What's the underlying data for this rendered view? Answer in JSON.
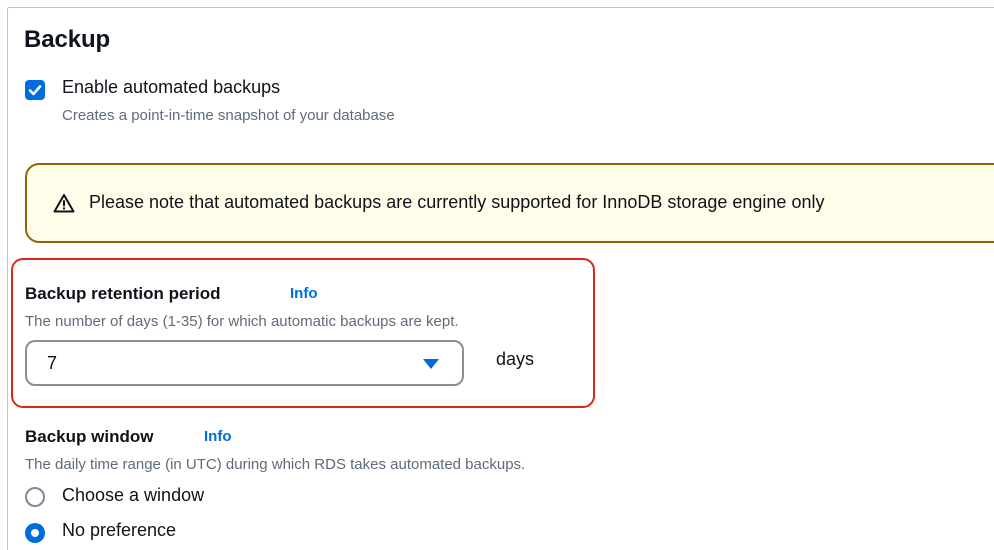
{
  "section": {
    "title": "Backup"
  },
  "automated_backups": {
    "label": "Enable automated backups",
    "description": "Creates a point-in-time snapshot of your database",
    "checked": true
  },
  "alert": {
    "icon": "warning-icon",
    "text": "Please note that automated backups are currently supported for InnoDB storage engine only"
  },
  "retention": {
    "label": "Backup retention period",
    "info": "Info",
    "description": "The number of days (1-35) for which automatic backups are kept.",
    "value": "7",
    "unit": "days"
  },
  "backup_window": {
    "label": "Backup window",
    "info": "Info",
    "description": "The daily time range (in UTC) during which RDS takes automated backups.",
    "options": [
      {
        "label": "Choose a window",
        "selected": false
      },
      {
        "label": "No preference",
        "selected": true
      }
    ]
  },
  "colors": {
    "accent": "#006ce0",
    "warning_border": "#8d6605",
    "warning_bg": "#fffce9",
    "highlight": "#d92a14"
  }
}
